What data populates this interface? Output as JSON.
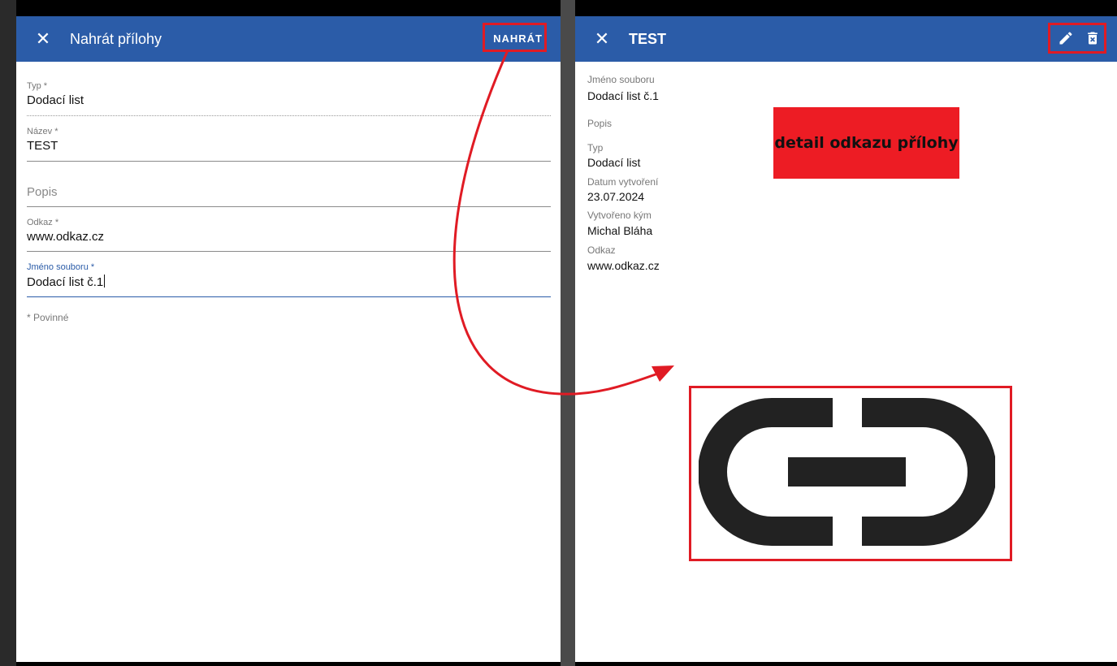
{
  "left_dialog": {
    "title": "Nahrát přílohy",
    "action_label": "NAHRÁT",
    "close_icon": "close-icon",
    "fields": {
      "typ": {
        "label": "Typ *",
        "value": "Dodací list"
      },
      "nazev": {
        "label": "Název *",
        "value": "TEST"
      },
      "popis": {
        "placeholder": "Popis"
      },
      "odkaz": {
        "label": "Odkaz *",
        "value": "www.odkaz.cz"
      },
      "jmeno": {
        "label": "Jméno souboru *",
        "value": "Dodací list č.1"
      }
    },
    "required_note": "* Povinné"
  },
  "right_dialog": {
    "title": "TEST",
    "close_icon": "close-icon",
    "edit_icon": "pencil-icon",
    "delete_icon": "delete-icon",
    "details": {
      "jmeno_label": "Jméno souboru",
      "jmeno_value": "Dodací list č.1",
      "popis_label": "Popis",
      "typ_label": "Typ",
      "typ_value": "Dodací list",
      "datum_label": "Datum vytvoření",
      "datum_value": "23.07.2024",
      "vytvoreno_label": "Vytvořeno kým",
      "vytvoreno_value": "Michal Bláha",
      "odkaz_label": "Odkaz",
      "odkaz_value": "www.odkaz.cz"
    }
  },
  "annotation": {
    "label": "detail odkazu přílohy",
    "color": "#ed1c24",
    "link_icon": "link-icon"
  },
  "colors": {
    "appbar": "#2b5ca8",
    "focus": "#2b5ca8",
    "highlight": "#e01b24"
  }
}
